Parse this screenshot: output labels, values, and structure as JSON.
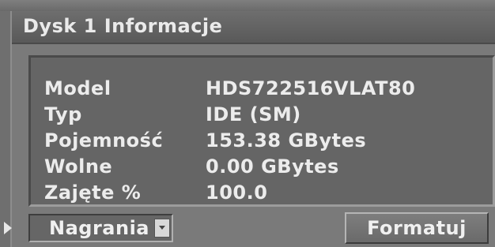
{
  "dialog": {
    "title": "Dysk 1 Informacje"
  },
  "info": [
    {
      "label": "Model",
      "value": "HDS722516VLAT80"
    },
    {
      "label": "Typ",
      "value": "IDE (SM)"
    },
    {
      "label": "Pojemność",
      "value": "153.38 GBytes"
    },
    {
      "label": "Wolne",
      "value": "0.00 GBytes"
    },
    {
      "label": "Zajęte %",
      "value": "100.0"
    }
  ],
  "controls": {
    "dropdown_value": "Nagrania",
    "format_label": "Formatuj"
  },
  "icons": {
    "focus_arrow": "arrow-right-icon",
    "dropdown_arrow": "chevron-down-icon"
  },
  "colors": {
    "background": "#7a7a7a",
    "title_bar": "#5f5f5f",
    "text": "#ececec"
  }
}
